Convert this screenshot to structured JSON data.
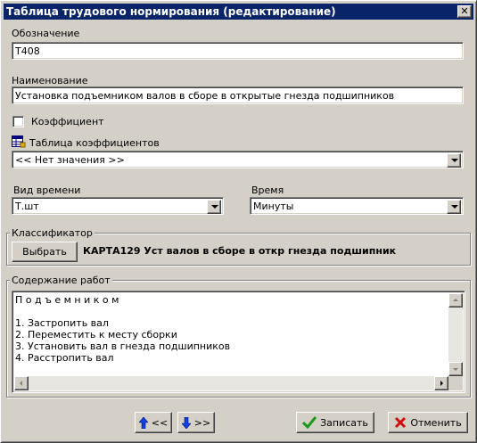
{
  "window": {
    "title": "Таблица трудового нормирования  (редактирование)",
    "close_glyph": "✕"
  },
  "designation": {
    "label": "Обозначение",
    "value": "Т408"
  },
  "name": {
    "label": "Наименование",
    "value": "Установка подъемником валов в сборе в открытые гнезда подшипников"
  },
  "coefficient": {
    "label": "Коэффициент",
    "checked": false
  },
  "coef_table": {
    "label": "Таблица коэффициентов",
    "value": "<< Нет значения >>",
    "icon": "table-icon"
  },
  "time_type": {
    "label": "Вид времени",
    "value": "Т.шт"
  },
  "time_unit": {
    "label": "Время",
    "value": "Минуты"
  },
  "classifier": {
    "group_label": "Классификатор",
    "select_label": "Выбрать",
    "value": "КАРТА129 Уст валов в сборе в откр гнезда подшипник"
  },
  "content": {
    "group_label": "Содержание работ",
    "lines": [
      "П о д ъ е м н и к о м",
      "",
      "1. Застропить вал",
      "2. Переместить к месту сборки",
      "3. Установить вал в гнезда подшипников",
      "4. Расстропить вал"
    ]
  },
  "footer": {
    "prev_label": "<<",
    "next_label": ">>",
    "save_label": "Записать",
    "cancel_label": "Отменить",
    "colors": {
      "arrow_blue": "#1040e0",
      "check_green": "#1a9a1a",
      "cancel_red": "#d01010"
    }
  }
}
